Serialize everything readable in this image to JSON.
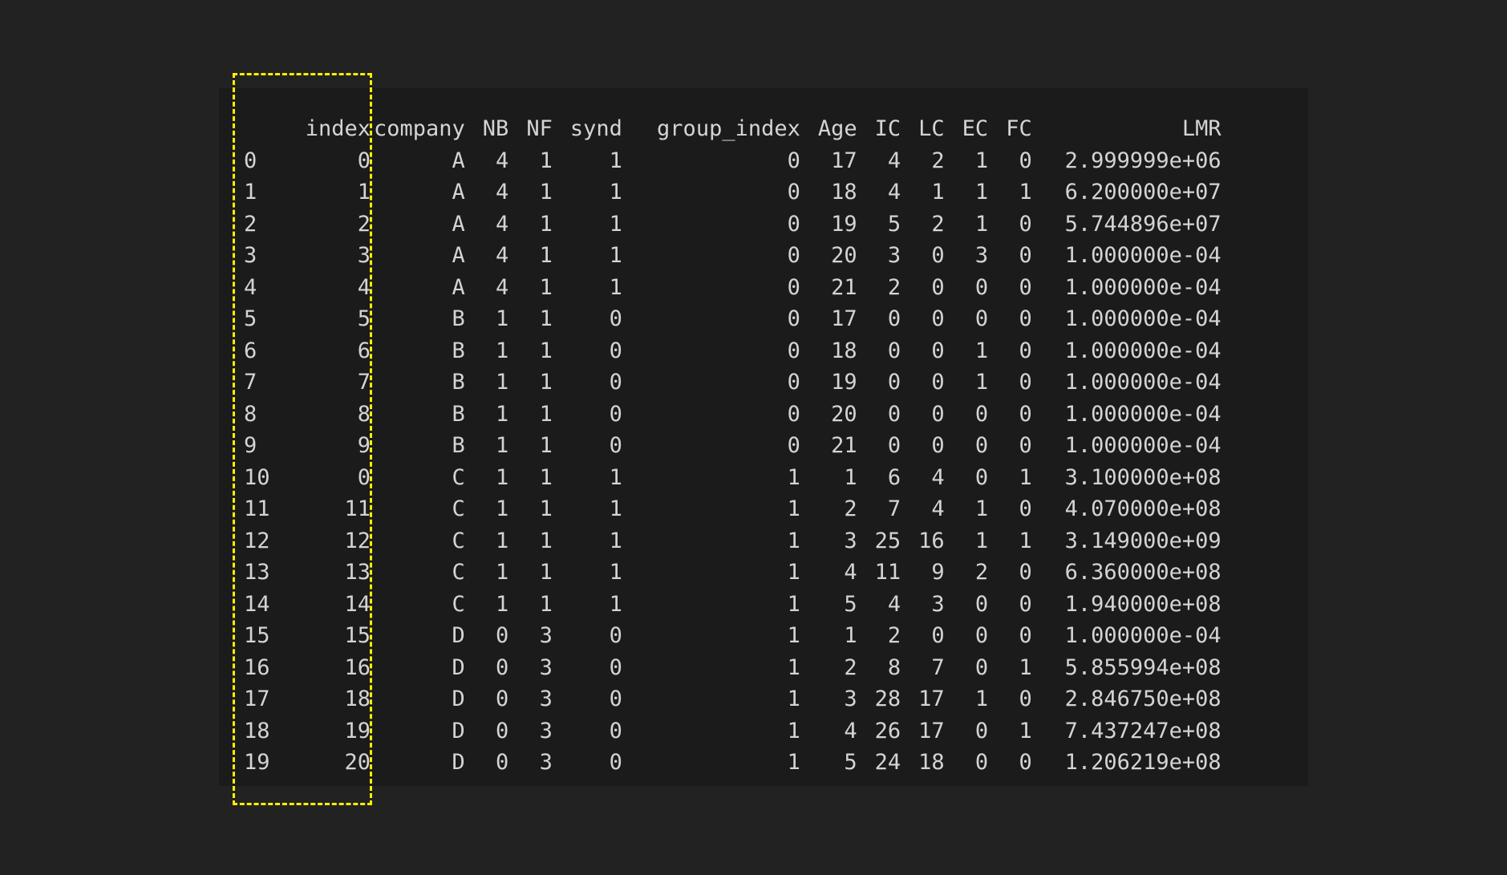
{
  "dataframe": {
    "columns": [
      {
        "key": "index",
        "label": "index"
      },
      {
        "key": "company",
        "label": "company"
      },
      {
        "key": "NB",
        "label": "NB"
      },
      {
        "key": "NF",
        "label": "NF"
      },
      {
        "key": "synd",
        "label": "synd"
      },
      {
        "key": "group_index",
        "label": "group_index"
      },
      {
        "key": "Age",
        "label": "Age"
      },
      {
        "key": "IC",
        "label": "IC"
      },
      {
        "key": "LC",
        "label": "LC"
      },
      {
        "key": "EC",
        "label": "EC"
      },
      {
        "key": "FC",
        "label": "FC"
      },
      {
        "key": "LMR",
        "label": "LMR"
      }
    ],
    "rows": [
      [
        "0",
        "0",
        "A",
        "4",
        "1",
        "1",
        "0",
        "17",
        "4",
        "2",
        "1",
        "0",
        "2.999999e+06"
      ],
      [
        "1",
        "1",
        "A",
        "4",
        "1",
        "1",
        "0",
        "18",
        "4",
        "1",
        "1",
        "1",
        "6.200000e+07"
      ],
      [
        "2",
        "2",
        "A",
        "4",
        "1",
        "1",
        "0",
        "19",
        "5",
        "2",
        "1",
        "0",
        "5.744896e+07"
      ],
      [
        "3",
        "3",
        "A",
        "4",
        "1",
        "1",
        "0",
        "20",
        "3",
        "0",
        "3",
        "0",
        "1.000000e-04"
      ],
      [
        "4",
        "4",
        "A",
        "4",
        "1",
        "1",
        "0",
        "21",
        "2",
        "0",
        "0",
        "0",
        "1.000000e-04"
      ],
      [
        "5",
        "5",
        "B",
        "1",
        "1",
        "0",
        "0",
        "17",
        "0",
        "0",
        "0",
        "0",
        "1.000000e-04"
      ],
      [
        "6",
        "6",
        "B",
        "1",
        "1",
        "0",
        "0",
        "18",
        "0",
        "0",
        "1",
        "0",
        "1.000000e-04"
      ],
      [
        "7",
        "7",
        "B",
        "1",
        "1",
        "0",
        "0",
        "19",
        "0",
        "0",
        "1",
        "0",
        "1.000000e-04"
      ],
      [
        "8",
        "8",
        "B",
        "1",
        "1",
        "0",
        "0",
        "20",
        "0",
        "0",
        "0",
        "0",
        "1.000000e-04"
      ],
      [
        "9",
        "9",
        "B",
        "1",
        "1",
        "0",
        "0",
        "21",
        "0",
        "0",
        "0",
        "0",
        "1.000000e-04"
      ],
      [
        "10",
        "0",
        "C",
        "1",
        "1",
        "1",
        "1",
        "1",
        "6",
        "4",
        "0",
        "1",
        "3.100000e+08"
      ],
      [
        "11",
        "11",
        "C",
        "1",
        "1",
        "1",
        "1",
        "2",
        "7",
        "4",
        "1",
        "0",
        "4.070000e+08"
      ],
      [
        "12",
        "12",
        "C",
        "1",
        "1",
        "1",
        "1",
        "3",
        "25",
        "16",
        "1",
        "1",
        "3.149000e+09"
      ],
      [
        "13",
        "13",
        "C",
        "1",
        "1",
        "1",
        "1",
        "4",
        "11",
        "9",
        "2",
        "0",
        "6.360000e+08"
      ],
      [
        "14",
        "14",
        "C",
        "1",
        "1",
        "1",
        "1",
        "5",
        "4",
        "3",
        "0",
        "0",
        "1.940000e+08"
      ],
      [
        "15",
        "15",
        "D",
        "0",
        "3",
        "0",
        "1",
        "1",
        "2",
        "0",
        "0",
        "0",
        "1.000000e-04"
      ],
      [
        "16",
        "16",
        "D",
        "0",
        "3",
        "0",
        "1",
        "2",
        "8",
        "7",
        "0",
        "1",
        "5.855994e+08"
      ],
      [
        "17",
        "18",
        "D",
        "0",
        "3",
        "0",
        "1",
        "3",
        "28",
        "17",
        "1",
        "0",
        "2.846750e+08"
      ],
      [
        "18",
        "19",
        "D",
        "0",
        "3",
        "0",
        "1",
        "4",
        "26",
        "17",
        "0",
        "1",
        "7.437247e+08"
      ],
      [
        "19",
        "20",
        "D",
        "0",
        "3",
        "0",
        "1",
        "5",
        "24",
        "18",
        "0",
        "0",
        "1.206219e+08"
      ]
    ]
  },
  "highlight": {
    "column": "index",
    "border_color": "#ffee00"
  },
  "colors": {
    "background": "#222222",
    "panel": "#1b1b1b",
    "text": "#d4d4d4"
  }
}
